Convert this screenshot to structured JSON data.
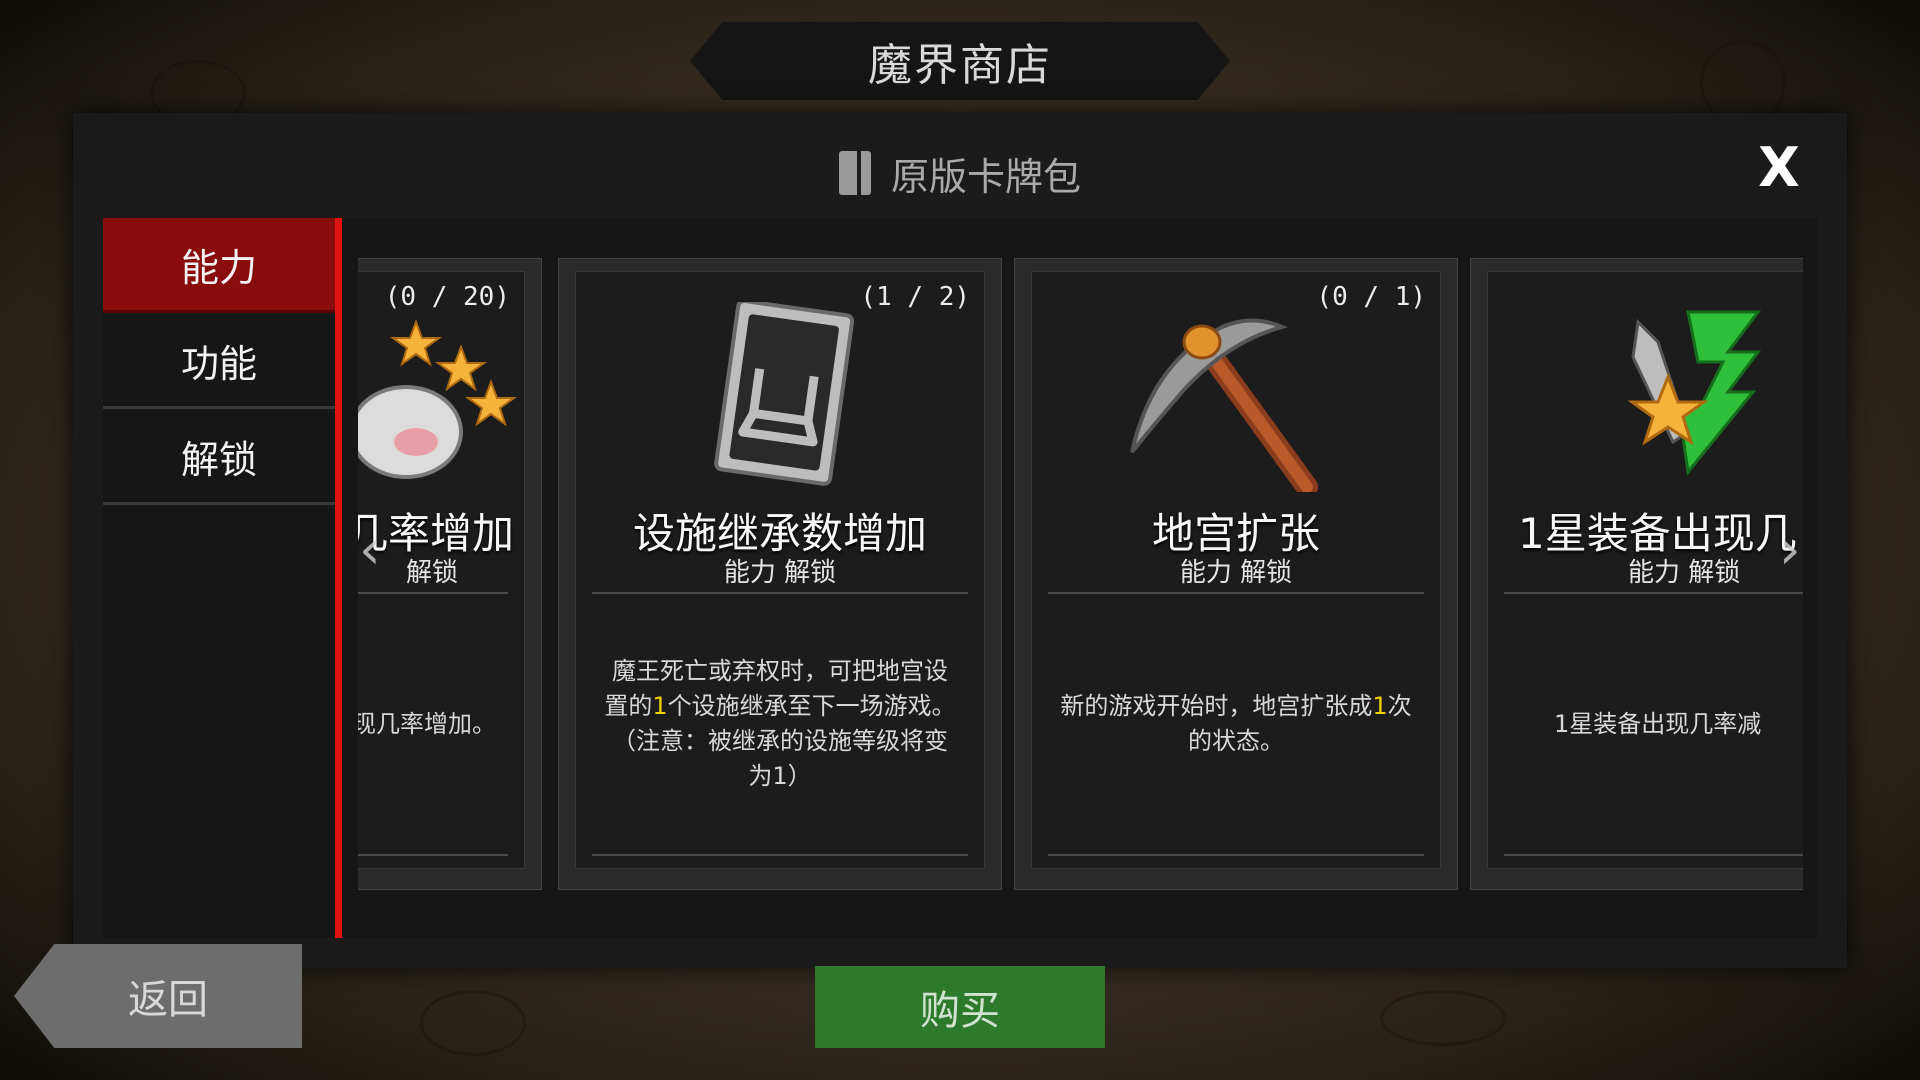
{
  "header": {
    "title": "魔界商店"
  },
  "panel": {
    "pack_title": "原版卡牌包",
    "close_label": "X"
  },
  "sidebar": {
    "tabs": [
      {
        "label": "能力",
        "active": true
      },
      {
        "label": "功能",
        "active": false
      },
      {
        "label": "解锁",
        "active": false
      }
    ]
  },
  "cards": [
    {
      "count": "(0 / 20)",
      "name": "现几率增加",
      "type": "解锁",
      "desc_parts": [
        "现几率增加。"
      ],
      "icon": "stars-egg-icon"
    },
    {
      "count": "(1 / 2)",
      "name": "设施继承数增加",
      "type": "能力 解锁",
      "desc_parts": [
        "魔王死亡或弃权时，可把地宫设置的",
        "1",
        "个设施继承至下一场游戏。（注意：被继承的设施等级将变为1）"
      ],
      "icon": "facility-card-icon"
    },
    {
      "count": "(0 / 1)",
      "name": "地宫扩张",
      "type": "能力 解锁",
      "desc_parts": [
        "新的游戏开始时，地宫扩张成",
        "1",
        "次的状态。"
      ],
      "icon": "pickaxe-icon"
    },
    {
      "count": "",
      "name": "1星装备出现几",
      "type": "能力 解锁",
      "desc_parts": [
        "1星装备出现几率减"
      ],
      "icon": "star-down-arrow-icon"
    }
  ],
  "nav": {
    "left_arrow": "‹",
    "right_arrow": "›"
  },
  "footer": {
    "back_label": "返回",
    "buy_label": "购买"
  },
  "colors": {
    "active_tab": "#8a0d0d",
    "accent_bar": "#e11212",
    "highlight": "#f0d000",
    "buy_button": "#2d7a2c"
  }
}
